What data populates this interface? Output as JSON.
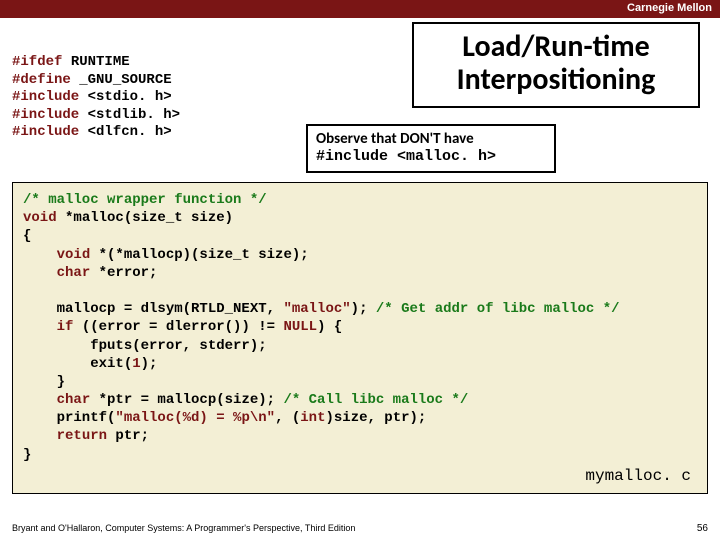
{
  "header": {
    "brand": "Carnegie Mellon"
  },
  "title": {
    "line1": "Load/Run-time",
    "line2": "Interpositioning"
  },
  "note": {
    "line1": "Observe that DON'T have",
    "line2": "#include <malloc. h>"
  },
  "preamble": {
    "l1a": "#ifdef ",
    "l1b": "RUNTIME",
    "l2a": "#define ",
    "l2b": "_GNU_SOURCE",
    "l3a": "#include ",
    "l3b": "<stdio. h>",
    "l4a": "#include ",
    "l4b": "<stdlib. h>",
    "l5a": "#include ",
    "l5b": "<dlfcn. h>"
  },
  "code": {
    "c1": "/* malloc wrapper function */",
    "l2a": "void",
    "l2b": " *malloc(size_t size)",
    "l3": "{",
    "l4a": "    ",
    "l4b": "void",
    "l4c": " *(*mallocp)(size_t size);",
    "l5a": "    ",
    "l5b": "char",
    "l5c": " *error;",
    "blank": "",
    "l7a": "    mallocp = dlsym(RTLD_NEXT, ",
    "l7b": "\"malloc\"",
    "l7c": "); ",
    "l7d": "/* Get addr of libc malloc */",
    "l8a": "    ",
    "l8b": "if",
    "l8c": " ((error = dlerror()) != ",
    "l8d": "NULL",
    "l8e": ") {",
    "l9": "        fputs(error, stderr);",
    "l10a": "        exit(",
    "l10b": "1",
    "l10c": ");",
    "l11": "    }",
    "l12a": "    ",
    "l12b": "char",
    "l12c": " *ptr = mallocp(size); ",
    "l12d": "/* Call libc malloc */",
    "l13a": "    printf(",
    "l13b": "\"malloc(%d) = %p\\n\"",
    "l13c": ", (",
    "l13d": "int",
    "l13e": ")size, ptr);",
    "l14a": "    ",
    "l14b": "return",
    "l14c": " ptr;",
    "l15": "}"
  },
  "filename": "mymalloc. c",
  "footer": {
    "credit": "Bryant and O'Hallaron, Computer Systems: A Programmer's Perspective, Third Edition",
    "page": "56"
  }
}
